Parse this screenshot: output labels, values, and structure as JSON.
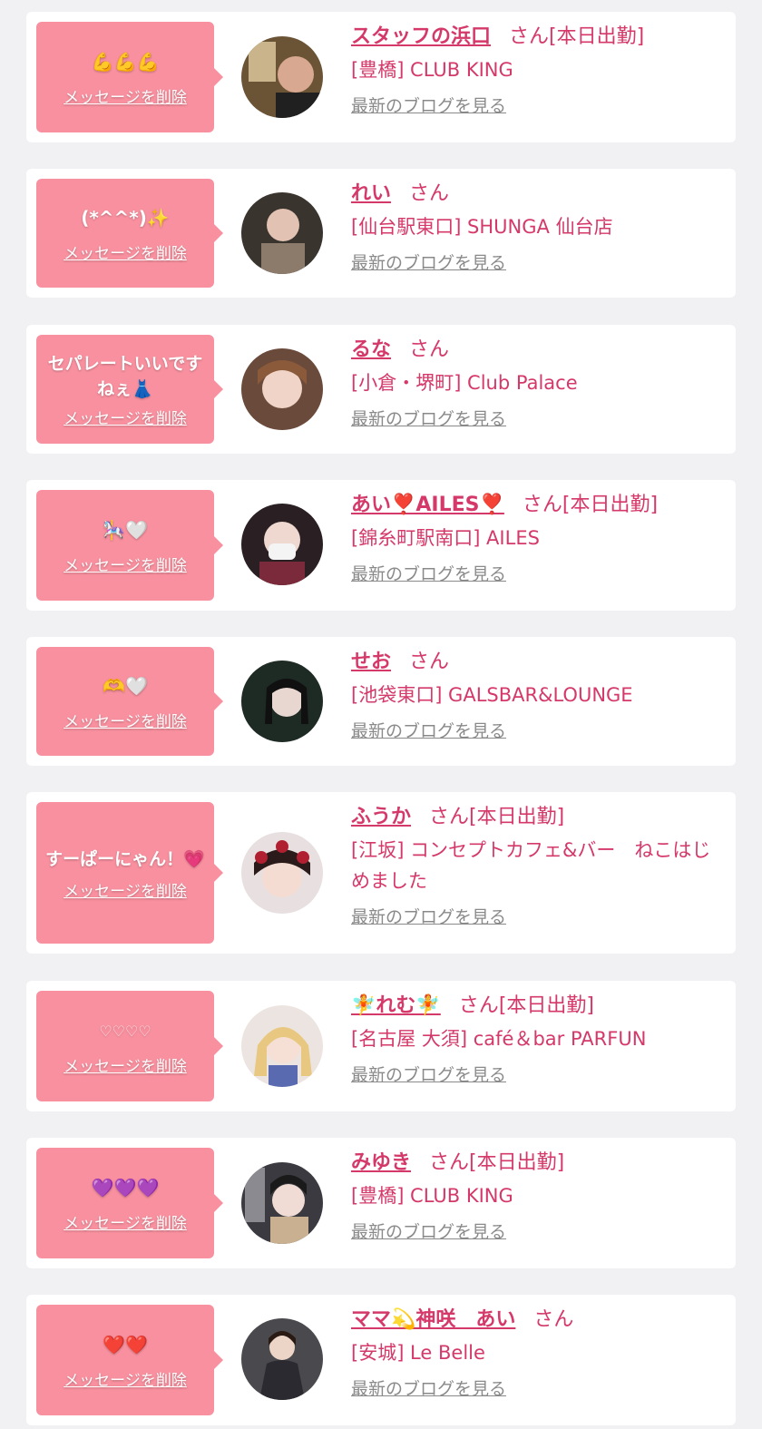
{
  "delete_label": "メッセージを削除",
  "blog_label": "最新のブログを見る",
  "san": "さん",
  "colors": {
    "accent": "#d4396a",
    "bubble": "#f8909f",
    "card": "#ffffff",
    "bg": "#f1f1f3",
    "link_gray": "#8a8a8a"
  },
  "messages": [
    {
      "message": "💪💪💪",
      "name": "スタッフの浜口",
      "status": "[本日出勤]",
      "shop": "[豊橋] CLUB KING"
    },
    {
      "message": "(*^^*)✨",
      "name": "れい",
      "status": "",
      "shop": "[仙台駅東口] SHUNGA 仙台店"
    },
    {
      "message": "セパレートいいですねぇ👗",
      "name": "るな",
      "status": "",
      "shop": "[小倉・堺町] Club Palace"
    },
    {
      "message": "🎠🤍",
      "name": "あい❣️AILES❣️",
      "status": "[本日出勤]",
      "shop": "[錦糸町駅南口] AILES"
    },
    {
      "message": "🫶🤍",
      "name": "せお",
      "status": "",
      "shop": "[池袋東口] GALSBAR&LOUNGE"
    },
    {
      "message": "すーぱーにゃん！💗",
      "name": "ふうか",
      "status": "[本日出勤]",
      "shop": "[江坂] コンセプトカフェ&バー　ねこはじめました"
    },
    {
      "message": "♡♡♡♡",
      "name": "🧚れむ🧚",
      "status": "[本日出勤]",
      "shop": "[名古屋 大須] café＆bar PARFUN"
    },
    {
      "message": "💜💜💜",
      "name": "みゆき",
      "status": "[本日出勤]",
      "shop": "[豊橋] CLUB KING"
    },
    {
      "message": "❤️❤️",
      "name": "ママ💫神咲　あい",
      "status": "",
      "shop": "[安城] Le Belle"
    }
  ]
}
